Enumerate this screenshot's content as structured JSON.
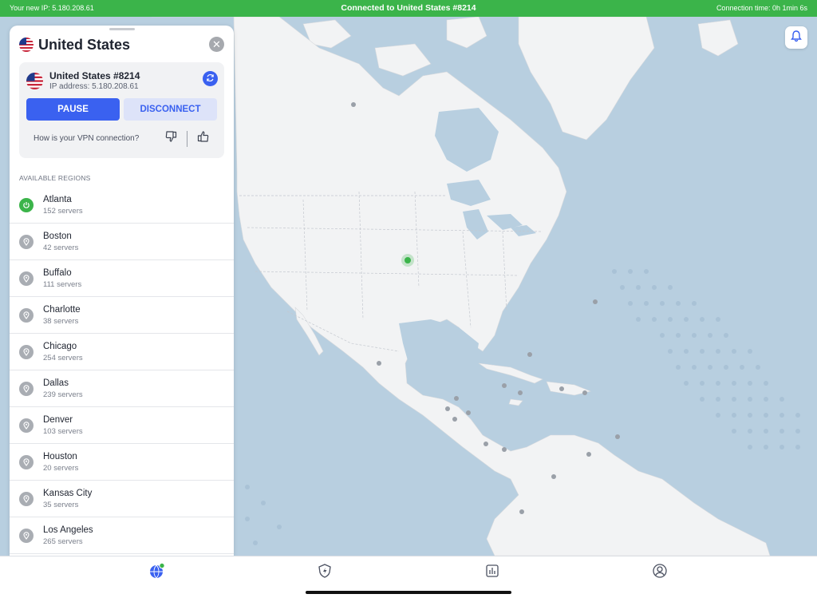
{
  "status_bar": {
    "new_ip": "Your new IP:  5.180.208.61",
    "connected": "Connected to United States #8214",
    "connection_time": "Connection time:  0h 1min 6s"
  },
  "panel": {
    "title": "United States",
    "server_name": "United States #8214",
    "ip_address": "IP address: 5.180.208.61",
    "pause_label": "PAUSE",
    "disconnect_label": "DISCONNECT",
    "feedback_question": "How is your VPN connection?",
    "regions_heading": "AVAILABLE REGIONS",
    "regions": [
      {
        "name": "Atlanta",
        "servers": "152 servers",
        "active": true
      },
      {
        "name": "Boston",
        "servers": "42 servers",
        "active": false
      },
      {
        "name": "Buffalo",
        "servers": "111 servers",
        "active": false
      },
      {
        "name": "Charlotte",
        "servers": "38 servers",
        "active": false
      },
      {
        "name": "Chicago",
        "servers": "254 servers",
        "active": false
      },
      {
        "name": "Dallas",
        "servers": "239 servers",
        "active": false
      },
      {
        "name": "Denver",
        "servers": "103 servers",
        "active": false
      },
      {
        "name": "Houston",
        "servers": "20 servers",
        "active": false
      },
      {
        "name": "Kansas City",
        "servers": "35 servers",
        "active": false
      },
      {
        "name": "Los Angeles",
        "servers": "265 servers",
        "active": false
      }
    ]
  },
  "icons": {
    "tabs": [
      "globe-icon",
      "bolt-shield-icon",
      "stats-icon",
      "profile-icon"
    ],
    "notifications": "bell-icon"
  },
  "colors": {
    "connected_green": "#3bb44a",
    "accent_blue": "#3a61f0",
    "ocean": "#b8cfe0",
    "land": "#f2f3f4"
  }
}
